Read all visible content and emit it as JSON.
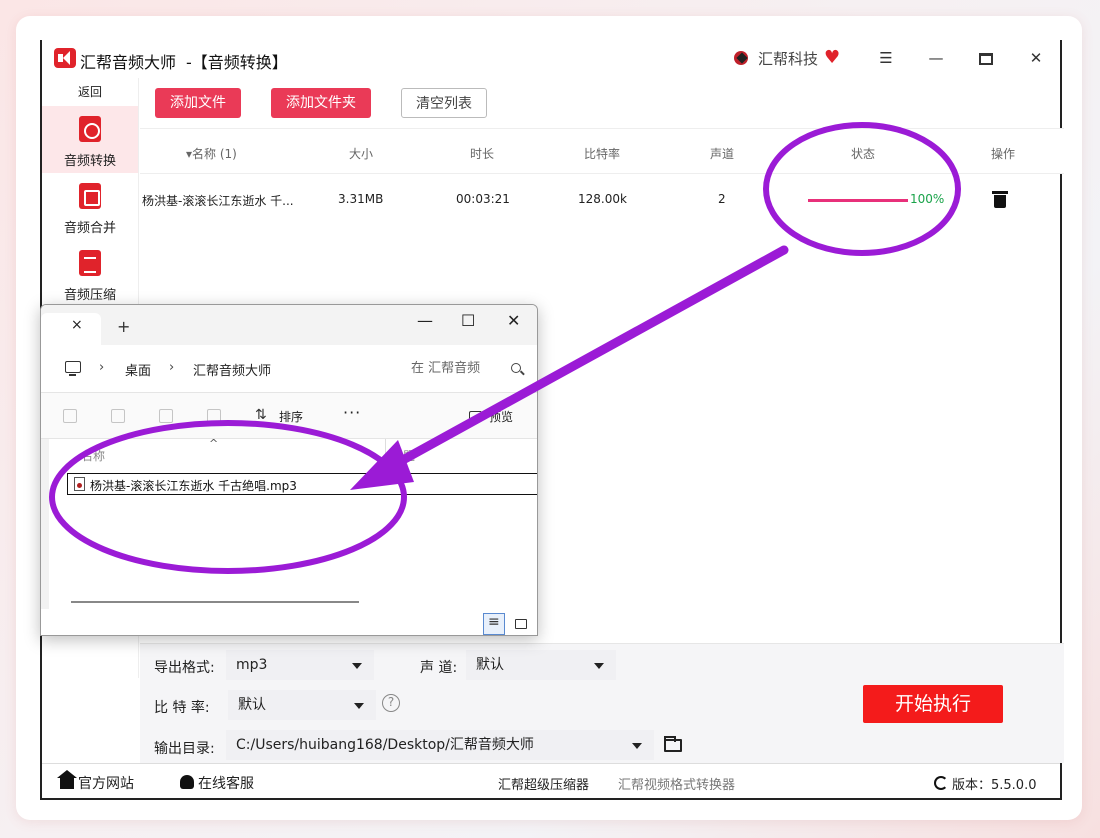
{
  "app": {
    "title": "汇帮音频大师",
    "subtitle": "-【音频转换】",
    "brand": "汇帮科技"
  },
  "sidebar": {
    "back": "返回",
    "items": [
      {
        "label": "音频转换",
        "icon": "audio-convert-icon",
        "active": true
      },
      {
        "label": "音频合并",
        "icon": "audio-merge-icon",
        "active": false
      },
      {
        "label": "音频压缩",
        "icon": "audio-compress-icon",
        "active": false
      }
    ]
  },
  "toolbar": {
    "add_file": "添加文件",
    "add_folder": "添加文件夹",
    "clear_list": "清空列表"
  },
  "table": {
    "headers": {
      "name": "▾名称 (1)",
      "size": "大小",
      "duration": "时长",
      "bitrate": "比特率",
      "channels": "声道",
      "status": "状态",
      "action": "操作"
    },
    "rows": [
      {
        "name": "杨洪基-滚滚长江东逝水  千...",
        "size": "3.31MB",
        "duration": "00:03:21",
        "bitrate": "128.00k",
        "channels": "2",
        "progress_percent": 100,
        "status_text": "100%"
      }
    ]
  },
  "settings": {
    "format_label": "导出格式:",
    "format_value": "mp3",
    "channel_label": "声 道:",
    "channel_value": "默认",
    "bitrate_label": "比 特 率:",
    "bitrate_value": "默认",
    "help_glyph": "?",
    "output_label": "输出目录:",
    "output_path": "C:/Users/huibang168/Desktop/汇帮音频大师",
    "start_button": "开始执行"
  },
  "footer": {
    "website": "官方网站",
    "support": "在线客服",
    "link1": "汇帮超级压缩器",
    "link2": "汇帮视频格式转换器",
    "version": "版本：5.5.0.0"
  },
  "explorer": {
    "tab_close": "×",
    "tab_add": "+",
    "breadcrumb": [
      "桌面",
      "汇帮音频大师"
    ],
    "search_placeholder": "在 汇帮音频",
    "sort_label": "排序",
    "more_label": "···",
    "preview_label": "预览",
    "col_name": "名称",
    "col_title": "标题",
    "file": "杨洪基-滚滚长江东逝水  千古绝唱.mp3"
  },
  "colors": {
    "accent_red": "#ea3a57",
    "start_red": "#f41b1b",
    "progress": "#e8307a",
    "status_green": "#1aa34a",
    "annotation_purple": "#9b1bd6"
  }
}
